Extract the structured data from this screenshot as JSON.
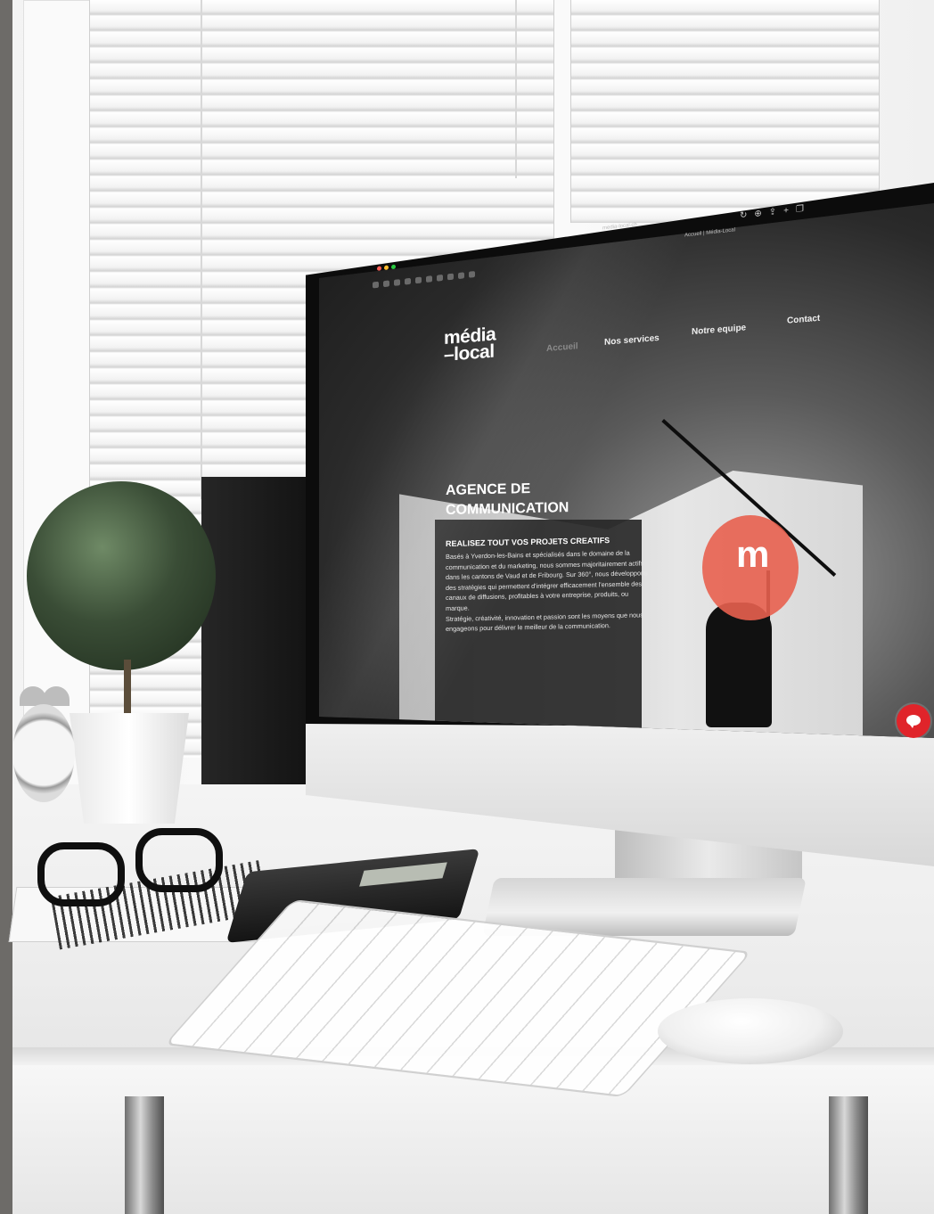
{
  "browser": {
    "url": "media-local.ch",
    "tab_title": "Accueil | Média-Local"
  },
  "site": {
    "logo_line1": "média",
    "logo_line2": "–local",
    "nav": [
      {
        "label": "Accueil"
      },
      {
        "label": "Nos services"
      },
      {
        "label": "Notre equipe"
      },
      {
        "label": "Contact"
      }
    ],
    "hero_title_line1": "AGENCE DE",
    "hero_title_line2": "COMMUNICATION",
    "hero_subtitle": "REALISEZ TOUT VOS PROJETS CREATIFS",
    "hero_body_1": "Basés à Yverdon-les-Bains et spécialisés dans le domaine de la communication et du marketing, nous sommes majoritairement actifs dans les cantons de Vaud et de Fribourg. Sur 360°, nous développons des stratégies qui permettent d'intégrer efficacement l'ensemble des canaux de diffusions, profitables à votre entreprise, produits, ou marque.",
    "hero_body_2": "Stratégie, créativité, innovation et passion sont les moyens que nous engageons pour délivrer le meilleur de la communication.",
    "brand_mark": "m"
  },
  "colors": {
    "accent_red": "#e8604f",
    "chat_red": "#e0242a"
  },
  "icons": {
    "chat": "chat-bubble-icon"
  }
}
